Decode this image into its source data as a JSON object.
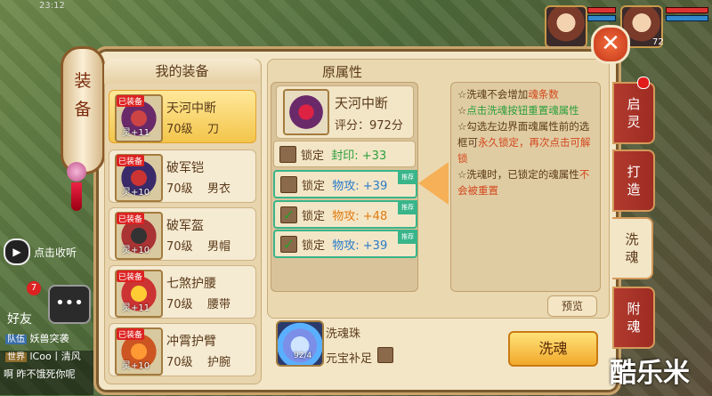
{
  "status_time": "23:12",
  "top_right": {
    "level": "72"
  },
  "scroll_label": [
    "装",
    "备"
  ],
  "equip_list": {
    "header": "我的装备",
    "items": [
      {
        "tag": "已装备",
        "ling": "灵+11",
        "name": "天河中断",
        "level": "70级",
        "type": "刀",
        "selected": true
      },
      {
        "tag": "已装备",
        "ling": "灵+10",
        "name": "破军铠",
        "level": "70级",
        "type": "男衣",
        "selected": false
      },
      {
        "tag": "已装备",
        "ling": "灵+10",
        "name": "破军盔",
        "level": "70级",
        "type": "男帽",
        "selected": false
      },
      {
        "tag": "已装备",
        "ling": "灵+11",
        "name": "七煞护腰",
        "level": "70级",
        "type": "腰带",
        "selected": false
      },
      {
        "tag": "已装备",
        "ling": "灵+10",
        "name": "冲霄护臂",
        "level": "70级",
        "type": "护腕",
        "selected": false
      }
    ]
  },
  "detail": {
    "title": "原属性",
    "equip_name": "天河中断",
    "score": "评分：972分",
    "attrs": [
      {
        "lock": "锁定",
        "stat": "封印: +33",
        "color": "#2c9f3c",
        "checked": false,
        "recommend": false
      },
      {
        "lock": "锁定",
        "stat": "物攻: +39",
        "color": "#2a7bc8",
        "checked": false,
        "recommend": true
      },
      {
        "lock": "锁定",
        "stat": "物攻: +48",
        "color": "#e07a10",
        "checked": true,
        "recommend": true
      },
      {
        "lock": "锁定",
        "stat": "物攻: +39",
        "color": "#2a7bc8",
        "checked": true,
        "recommend": true
      }
    ],
    "recommend_label": "推荐"
  },
  "info": {
    "lines": [
      {
        "pre": "☆洗魂不会增加",
        "hl": "魂条数",
        "post": ""
      },
      {
        "pre": "☆",
        "hl": "点击洗魂按钮重置魂属性",
        "post": ""
      },
      {
        "pre": "☆勾选左边界面魂属性前的选框可",
        "hl": "永久锁定，再次点击可解锁",
        "post": ""
      },
      {
        "pre": "☆洗魂时，已锁定的魂属性",
        "hl": "不会被重置",
        "post": ""
      }
    ]
  },
  "preview_button": "预览",
  "pearl": {
    "name": "洗魂珠",
    "count": "92/4",
    "supplement": "元宝补足"
  },
  "wash_button": "洗魂",
  "tabs": [
    {
      "label": [
        "启",
        "灵"
      ],
      "active": false
    },
    {
      "label": [
        "打",
        "造"
      ],
      "active": false
    },
    {
      "label": [
        "洗",
        "魂"
      ],
      "active": true
    },
    {
      "label": [
        "附",
        "魂"
      ],
      "active": false
    }
  ],
  "left_side": {
    "collect": "点击收听",
    "friends": "好友",
    "friend_badge": "7",
    "chat": [
      {
        "tag": "队伍",
        "text": "妖兽突袭"
      },
      {
        "tag": "世界",
        "text": "lCoo丨清风"
      },
      {
        "tag": "",
        "text": "啊 昨不饿死你呢"
      }
    ]
  },
  "watermark": "酷乐米"
}
